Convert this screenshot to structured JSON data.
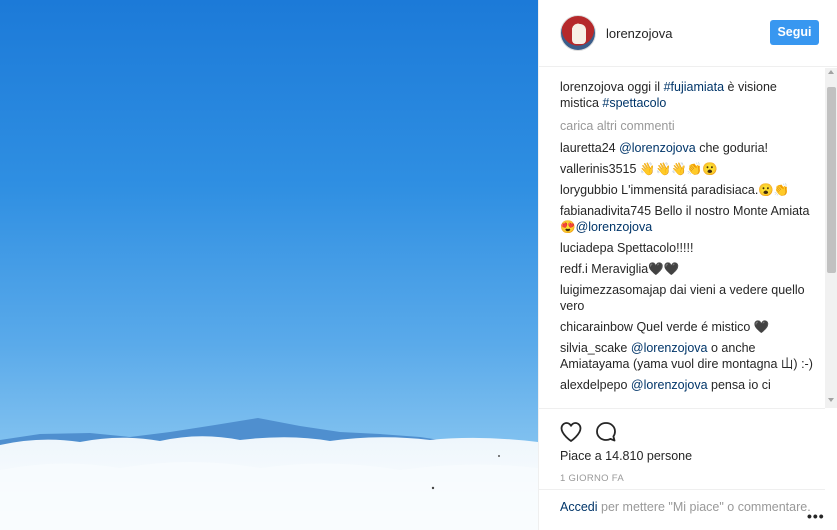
{
  "post": {
    "username": "lorenzojova",
    "follow_label": "Segui",
    "caption": {
      "user": "lorenzojova",
      "text1": "oggi il",
      "tag1": "#fujiamiata",
      "text2": "è visione mistica",
      "tag2": "#spettacolo"
    },
    "load_more": "carica altri commenti",
    "comments": [
      {
        "user": "lauretta24",
        "mention": "@lorenzojova",
        "text": "che goduria!"
      },
      {
        "user": "vallerinis3515",
        "mention": "",
        "text": "👋👋👋👏😮"
      },
      {
        "user": "lorygubbio",
        "mention": "",
        "text": "L'immensitá paradisiaca.😮👏"
      },
      {
        "user": "fabianadivita745",
        "mention": "@lorenzojova",
        "text": "Bello il nostro Monte Amiata 😍"
      },
      {
        "user": "luciadepa",
        "mention": "",
        "text": "Spettacolo!!!!!"
      },
      {
        "user": "redf.i",
        "mention": "",
        "text": "Meraviglia🖤🖤"
      },
      {
        "user": "luigimezzasomajap",
        "mention": "",
        "text": "dai vieni a vedere quello vero"
      },
      {
        "user": "chicarainbow",
        "mention": "",
        "text": "Quel verde é mistico 🖤"
      },
      {
        "user": "silvia_scake",
        "mention": "@lorenzojova",
        "text": "o anche Amiatayama (yama vuol dire montagna 山) :-)"
      },
      {
        "user": "alexdelpepo",
        "mention": "@lorenzojova",
        "text": "pensa io ci"
      }
    ],
    "likes_text": "Piace a 14.810 persone",
    "time_text": "1 GIORNO FA",
    "login_link": "Accedi",
    "login_text": "per mettere \"Mi piace\" o commentare.",
    "more_label": "•••"
  },
  "icons": {
    "like": "heart-icon",
    "comment": "speech-bubble-icon",
    "more": "ellipsis-icon"
  },
  "colors": {
    "accent": "#3897f0",
    "link": "#003569",
    "muted": "#999999",
    "sky": "#2f8fe2"
  }
}
